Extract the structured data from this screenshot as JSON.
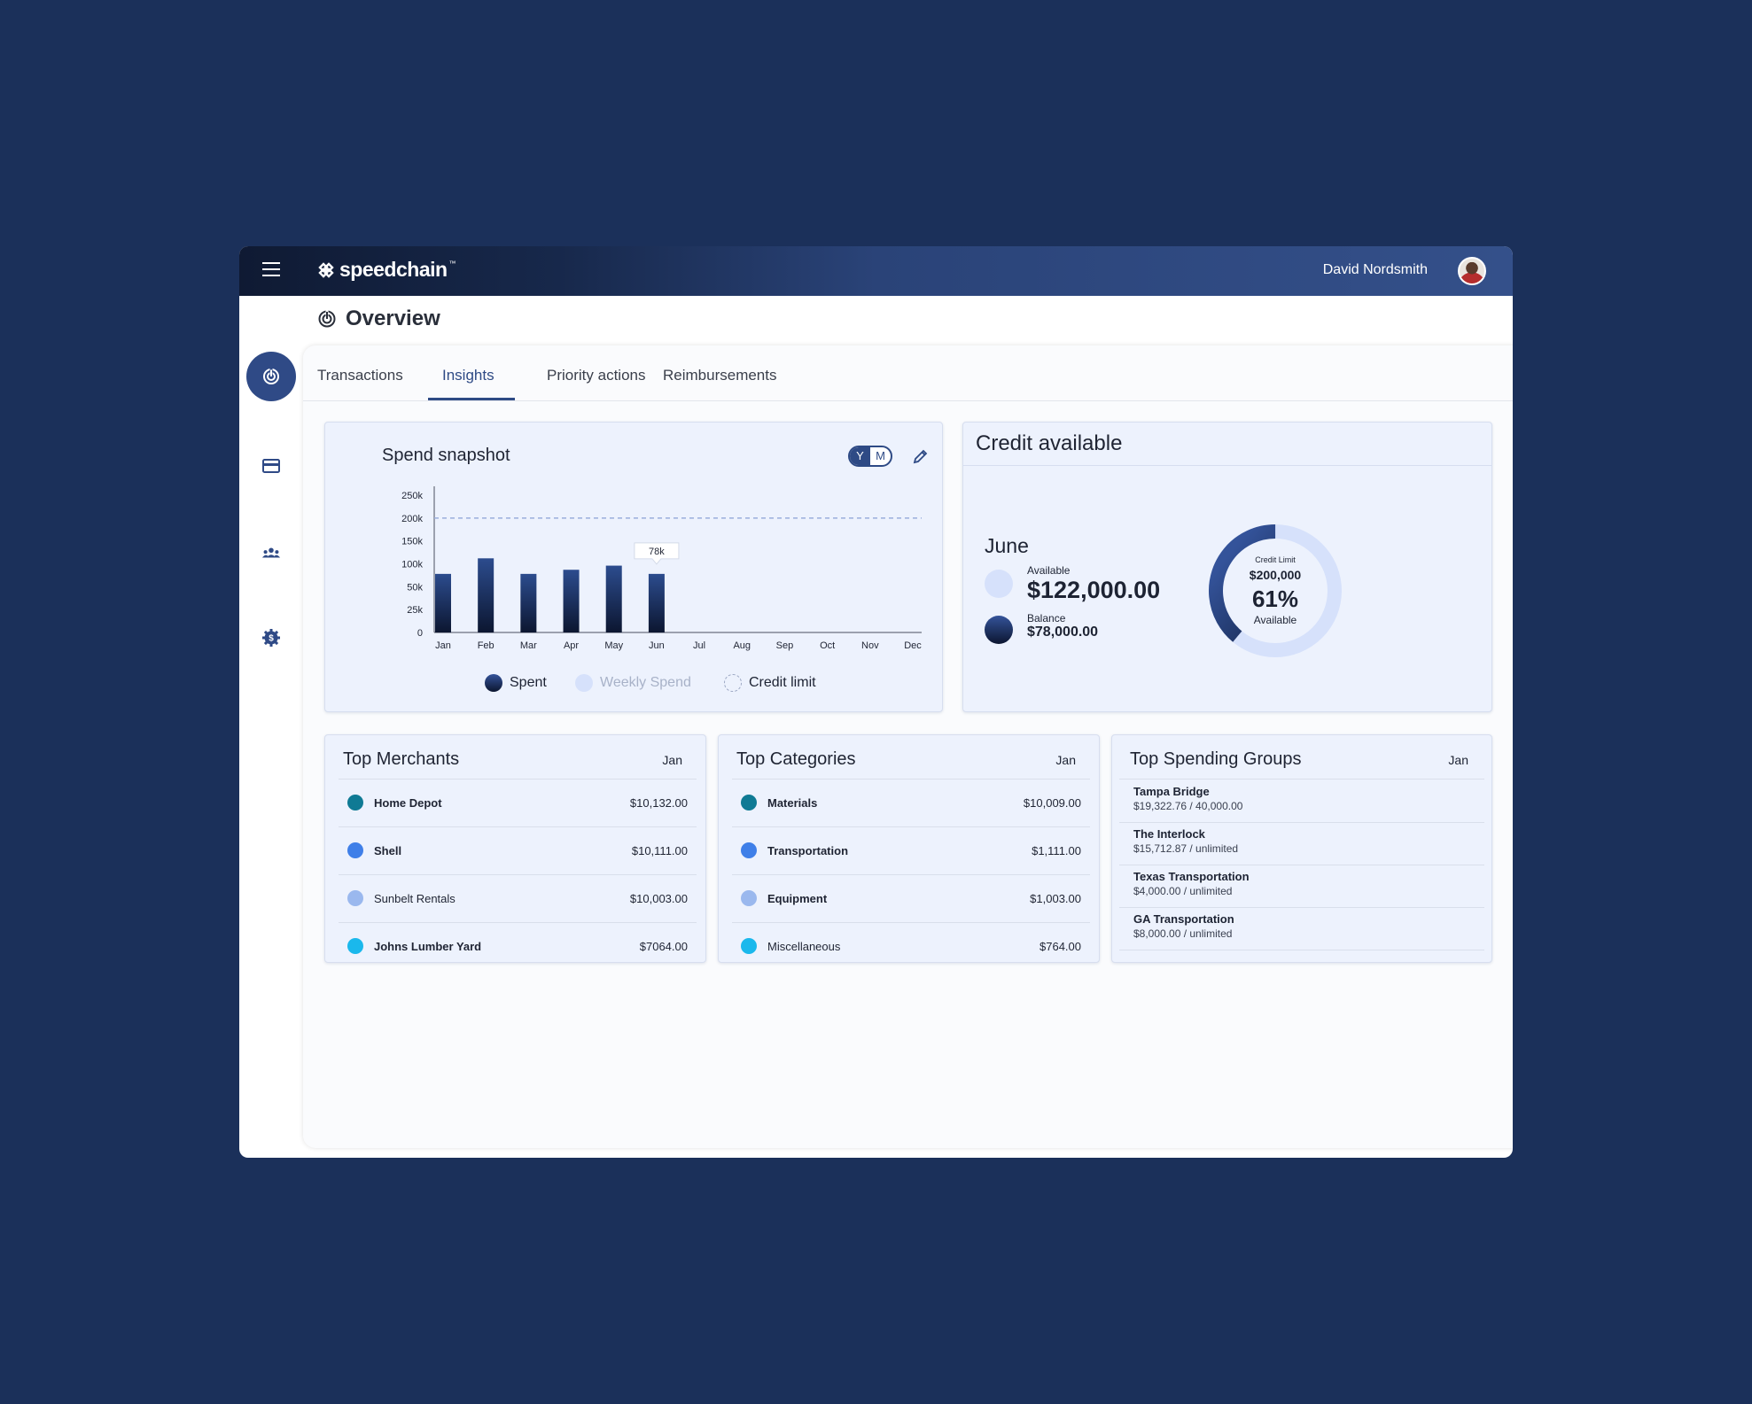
{
  "app": {
    "brand": "speedchain",
    "brand_tm": "™",
    "user_name": "David Nordsmith"
  },
  "page": {
    "title": "Overview"
  },
  "tabs": [
    {
      "label": "Transactions",
      "active": false
    },
    {
      "label": "Insights",
      "active": true
    },
    {
      "label": "Priority actions",
      "active": false
    },
    {
      "label": "Reimbursements",
      "active": false
    }
  ],
  "spend_snapshot": {
    "title": "Spend snapshot",
    "toggle": {
      "y": "Y",
      "m": "M",
      "selected": "Y"
    },
    "tooltip": "78k",
    "legend": {
      "spent": "Spent",
      "weekly": "Weekly Spend",
      "limit": "Credit limit"
    }
  },
  "chart_data": {
    "type": "bar",
    "title": "Spend snapshot",
    "categories": [
      "Jan",
      "Feb",
      "Mar",
      "Apr",
      "May",
      "Jun",
      "Jul",
      "Aug",
      "Sep",
      "Oct",
      "Nov",
      "Dec"
    ],
    "series": [
      {
        "name": "Spent",
        "values": [
          78000,
          112000,
          78000,
          87000,
          96000,
          78000,
          null,
          null,
          null,
          null,
          null,
          null
        ]
      }
    ],
    "reference_line": {
      "name": "Credit limit",
      "value": 200000,
      "style": "dashed"
    },
    "yticks": [
      0,
      25000,
      50000,
      100000,
      150000,
      200000,
      250000
    ],
    "ytick_labels": [
      "0",
      "25k",
      "50k",
      "100k",
      "150k",
      "200k",
      "250k"
    ],
    "ylim": [
      0,
      250000
    ],
    "grid": false,
    "legend_position": "bottom"
  },
  "credit": {
    "title": "Credit available",
    "month": "June",
    "available_label": "Available",
    "available_value": "$122,000.00",
    "balance_label": "Balance",
    "balance_value": "$78,000.00",
    "donut": {
      "limit_label": "Credit Limit",
      "limit_value": "$200,000",
      "percent": "61%",
      "percent_label": "Available",
      "available_fraction": 0.61
    }
  },
  "top_merchants": {
    "title": "Top Merchants",
    "period": "Jan",
    "items": [
      {
        "name": "Home Depot",
        "amount": "$10,132.00",
        "color": "#0f7a94"
      },
      {
        "name": "Shell",
        "amount": "$10,111.00",
        "color": "#3f7fe8"
      },
      {
        "name": "Sunbelt Rentals",
        "amount": "$10,003.00",
        "color": "#9ab8ee"
      },
      {
        "name": "Johns Lumber Yard",
        "amount": "$7064.00",
        "color": "#1ab8ec"
      }
    ]
  },
  "top_categories": {
    "title": "Top Categories",
    "period": "Jan",
    "items": [
      {
        "name": "Materials",
        "amount": "$10,009.00",
        "color": "#0f7a94"
      },
      {
        "name": "Transportation",
        "amount": "$1,111.00",
        "color": "#3f7fe8"
      },
      {
        "name": "Equipment",
        "amount": "$1,003.00",
        "color": "#9ab8ee"
      },
      {
        "name": "Miscellaneous",
        "amount": "$764.00",
        "color": "#1ab8ec"
      }
    ]
  },
  "top_groups": {
    "title": "Top Spending Groups",
    "period": "Jan",
    "items": [
      {
        "name": "Tampa Bridge",
        "detail": "$19,322.76 / 40,000.00"
      },
      {
        "name": "The Interlock",
        "detail": "$15,712.87 / unlimited"
      },
      {
        "name": "Texas Transportation",
        "detail": "$4,000.00 / unlimited"
      },
      {
        "name": "GA Transportation",
        "detail": "$8,000.00 / unlimited"
      }
    ]
  },
  "colors": {
    "background": "#1b305a",
    "accent": "#2e4a85",
    "card": "#edf2fd"
  }
}
